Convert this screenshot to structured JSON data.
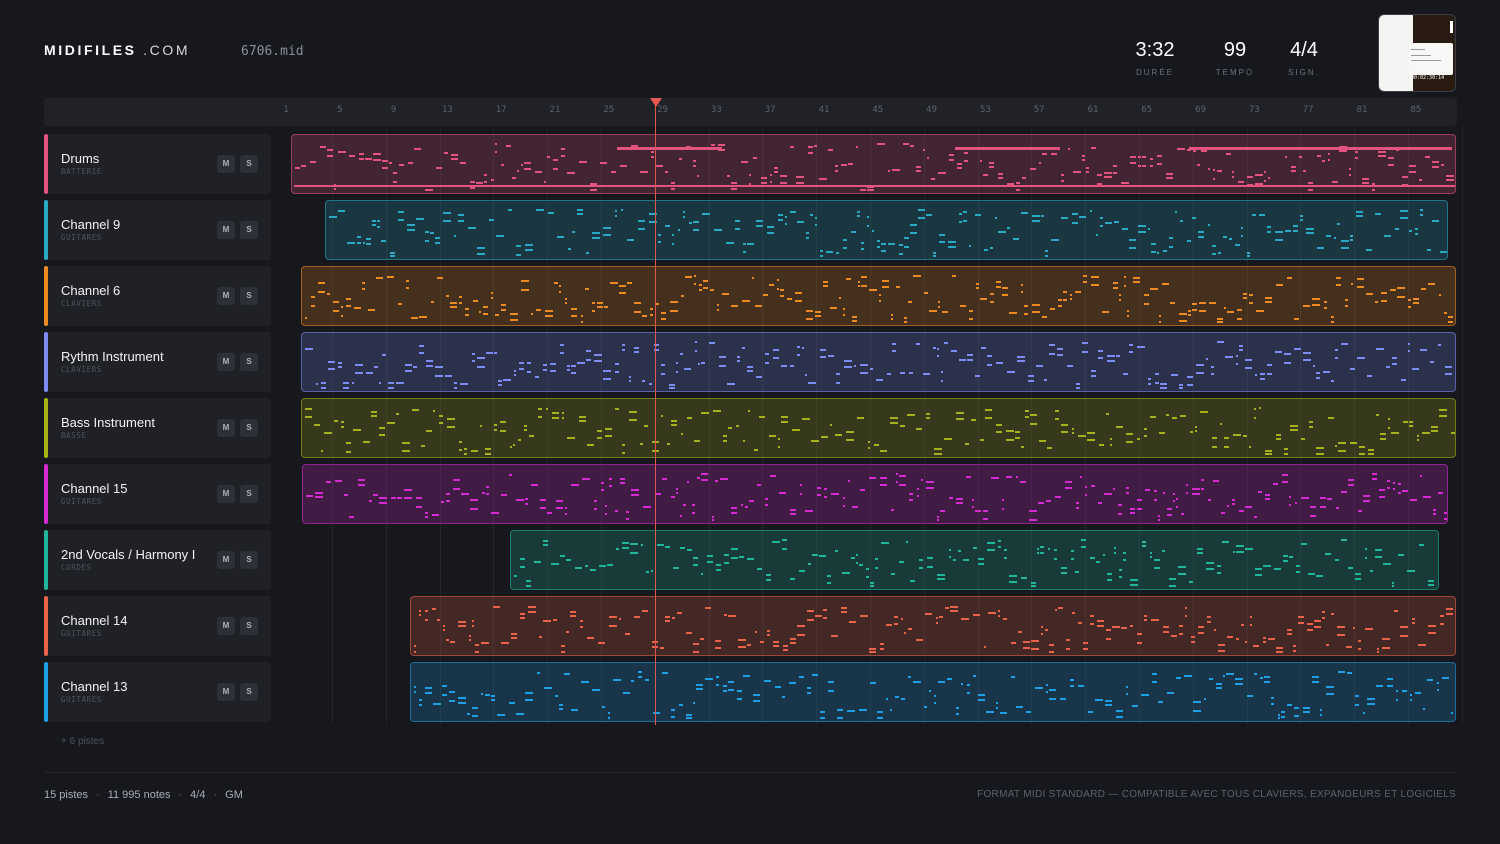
{
  "brand": {
    "bold": "MIDIFILES",
    "light": ".COM"
  },
  "file": {
    "name": "6706.mid"
  },
  "stats": [
    {
      "value": "3:32",
      "label": "DURÉE"
    },
    {
      "value": "99",
      "label": "TEMPO"
    },
    {
      "value": "4/4",
      "label": "SIGN."
    }
  ],
  "thumbnail": {
    "time": "00:02:30:14",
    "icon": "video-thumbnail"
  },
  "ruler": {
    "bars": [
      "1",
      "5",
      "9",
      "13",
      "17",
      "21",
      "25",
      "29",
      "33",
      "37",
      "41",
      "45",
      "49",
      "53",
      "57",
      "61",
      "65",
      "69",
      "73",
      "77",
      "81",
      "85"
    ]
  },
  "playhead": {
    "bar": 29
  },
  "tracks": [
    {
      "name": "Drums",
      "category": "BATTERIE",
      "color": "#e2537f",
      "mute": "M",
      "solo": "S"
    },
    {
      "name": "Channel 9",
      "category": "GUITARES",
      "color": "#2aa9c4",
      "mute": "M",
      "solo": "S"
    },
    {
      "name": "Channel 6",
      "category": "CLAVIERS",
      "color": "#ee8a22",
      "mute": "M",
      "solo": "S"
    },
    {
      "name": "Rythm Instrument",
      "category": "CLAVIERS",
      "color": "#7d8cf2",
      "mute": "M",
      "solo": "S"
    },
    {
      "name": "Bass Instrument",
      "category": "BASSE",
      "color": "#a7b21a",
      "mute": "M",
      "solo": "S"
    },
    {
      "name": "Channel 15",
      "category": "GUITARES",
      "color": "#d42bd2",
      "mute": "M",
      "solo": "S"
    },
    {
      "name": "2nd Vocals / Harmony I",
      "category": "CORDES",
      "color": "#1fb69c",
      "mute": "M",
      "solo": "S"
    },
    {
      "name": "Channel 14",
      "category": "GUITARES",
      "color": "#e8634a",
      "mute": "M",
      "solo": "S"
    },
    {
      "name": "Channel 13",
      "category": "GUITARES",
      "color": "#1f9fe6",
      "mute": "M",
      "solo": "S"
    }
  ],
  "more_tracks": "+ 6 pistes",
  "footer": {
    "tracks": "15 pistes",
    "notes": "11 995 notes",
    "signature": "4/4",
    "standard": "GM",
    "info": "FORMAT MIDI STANDARD — COMPATIBLE AVEC TOUS CLAVIERS, EXPANDEURS ET LOGICIELS"
  }
}
